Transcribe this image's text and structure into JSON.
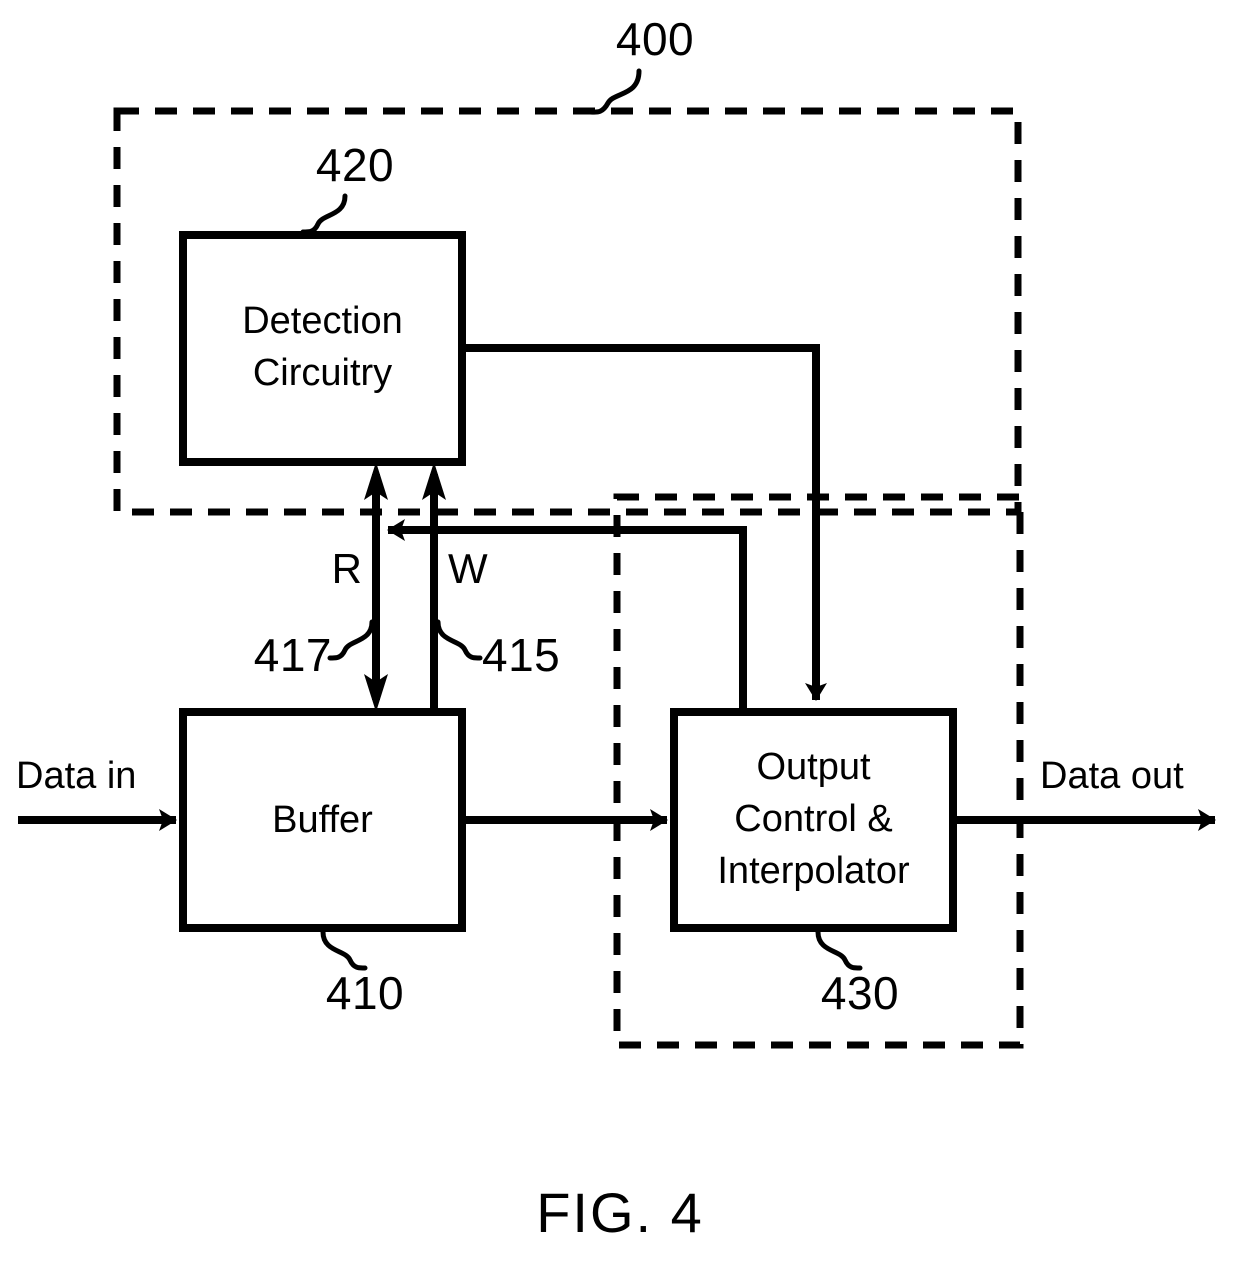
{
  "figure": {
    "caption": "FIG. 4",
    "system_ref": "400"
  },
  "blocks": [
    {
      "name": "detection-circuitry",
      "label_line1": "Detection",
      "label_line2": "Circuitry",
      "ref": "420"
    },
    {
      "name": "buffer",
      "label_line1": "Buffer",
      "label_line2": "",
      "ref": "410"
    },
    {
      "name": "output-control-interpolator",
      "label_line1": "Output",
      "label_line2": "Control &",
      "label_line3": "Interpolator",
      "ref": "430"
    }
  ],
  "signals": {
    "data_in": "Data in",
    "data_out": "Data out",
    "read": "R",
    "write": "W",
    "read_ref": "417",
    "write_ref": "415"
  },
  "colors": {
    "stroke": "#000000",
    "background": "#ffffff"
  }
}
